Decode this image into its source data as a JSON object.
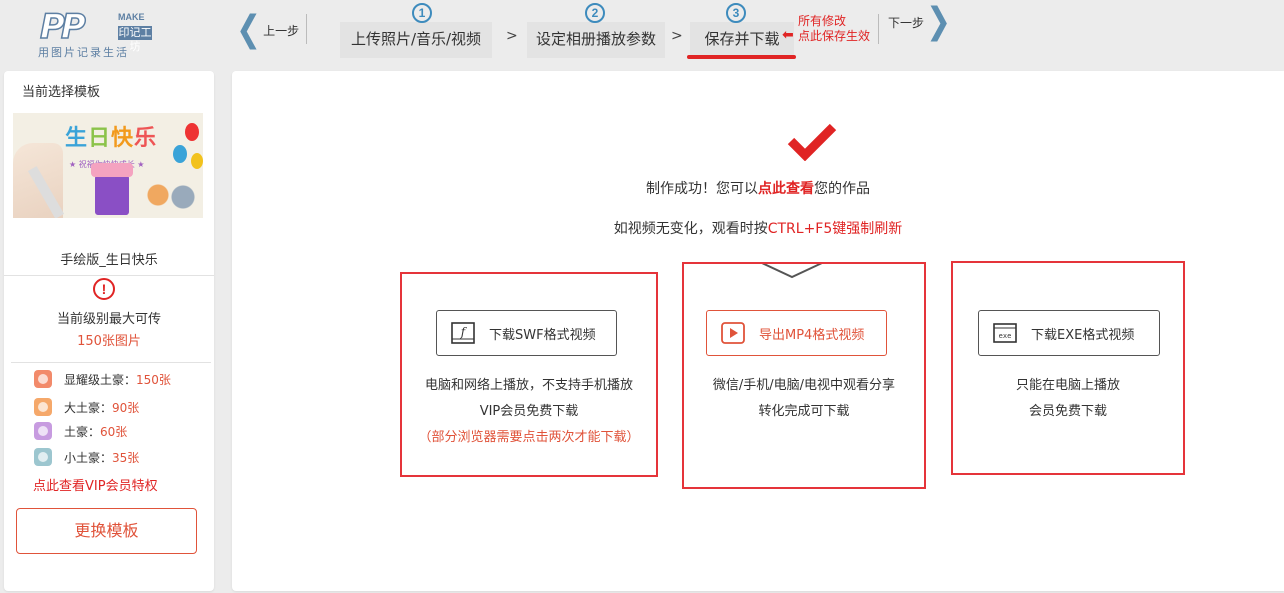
{
  "logo": {
    "pp": "PP",
    "make": "MAKE",
    "brand": "印记工坊",
    "slogan": "用图片记录生活"
  },
  "nav": {
    "prev_label": "上一步",
    "next_label": "下一步",
    "steps": [
      {
        "num": "1",
        "label": "上传照片/音乐/视频"
      },
      {
        "num": "2",
        "label": "设定相册播放参数"
      },
      {
        "num": "3",
        "label": "保存并下载"
      }
    ],
    "separator": ">",
    "save_hint": {
      "line1": "所有修改",
      "line2": "点此保存生效"
    }
  },
  "sidebar": {
    "heading": "当前选择模板",
    "thumb": {
      "title_chars": [
        "生",
        "日",
        "快",
        "乐"
      ],
      "subtitle": "★ 祝福你快快成长 ★"
    },
    "template_name": "手绘版_生日快乐",
    "limit_label": "当前级别最大可传",
    "limit_value": "150张图片",
    "levels": [
      {
        "name": "显耀级土豪：",
        "count": "150张",
        "color": "#f28a6a"
      },
      {
        "name": "大土豪：",
        "count": "90张",
        "color": "#f5a86a"
      },
      {
        "name": "土豪：",
        "count": "60张",
        "color": "#c79be0"
      },
      {
        "name": "小土豪：",
        "count": "35张",
        "color": "#9cc6cf"
      }
    ],
    "vip_link": "点此查看VIP会员特权",
    "change_button": "更换模板"
  },
  "main": {
    "success_prefix": "制作成功！您可以",
    "success_link": "点此查看",
    "success_suffix": "您的作品",
    "refresh_prefix": "如视频无变化，观看时按",
    "refresh_key": "CTRL+F5键强制刷新",
    "options": [
      {
        "button": "下载SWF格式视频",
        "icon": "flash-icon",
        "lines": [
          "电脑和网络上播放，不支持手机播放",
          "VIP会员免费下载"
        ],
        "note": "（部分浏览器需要点击两次才能下载）"
      },
      {
        "button": "导出MP4格式视频",
        "icon": "play-icon",
        "lines": [
          "微信/手机/电脑/电视中观看分享",
          "转化完成可下载"
        ],
        "note": ""
      },
      {
        "button": "下载EXE格式视频",
        "icon": "exe-icon",
        "lines": [
          "只能在电脑上播放",
          "会员免费下载"
        ],
        "note": ""
      }
    ]
  },
  "colors": {
    "accent": "#e02424",
    "nav_blue": "#5d8fb1",
    "step_blue": "#3d8bbd",
    "orange_text": "#e0533a"
  }
}
